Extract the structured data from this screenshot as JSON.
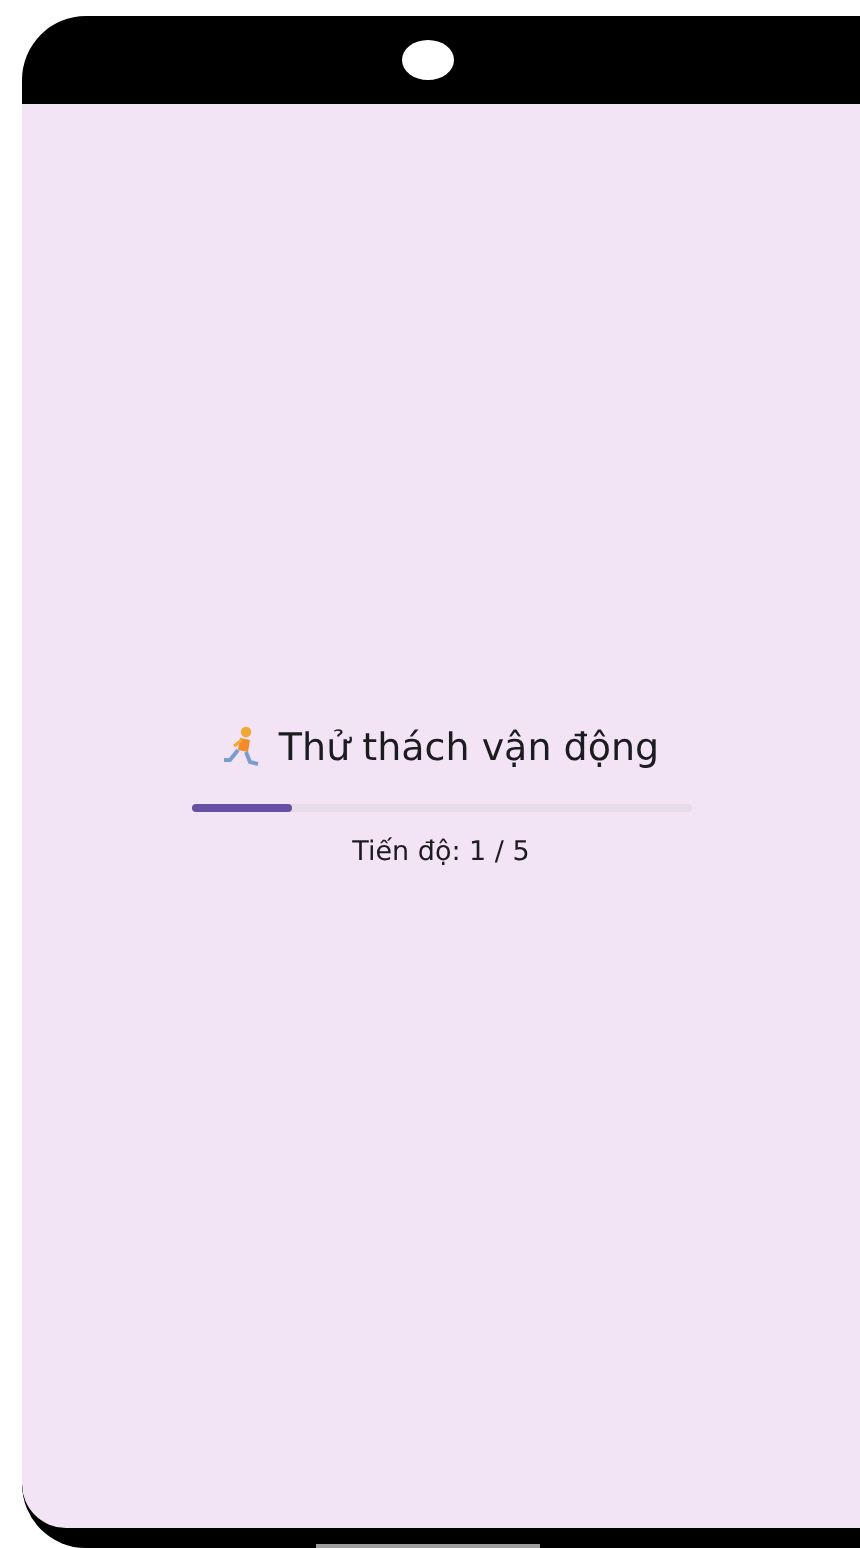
{
  "challenge": {
    "title": "Thử thách vận động",
    "level": 0.2,
    "progress_text": "Tiến độ: 1 / 5"
  }
}
